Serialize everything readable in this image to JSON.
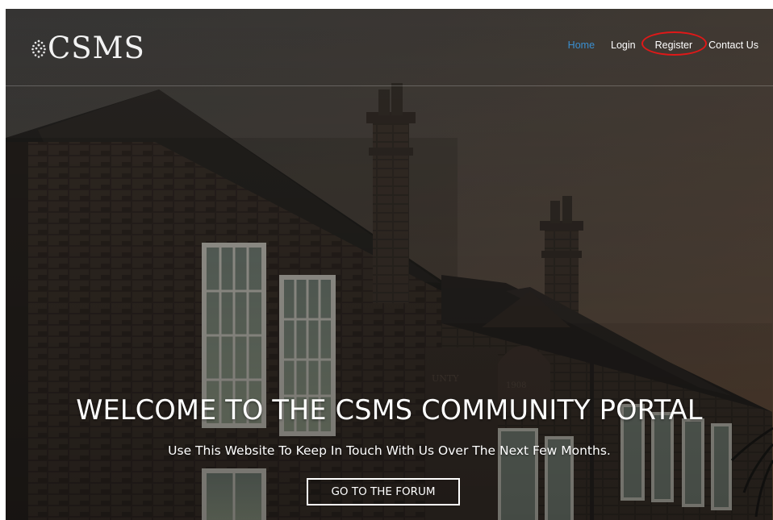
{
  "header": {
    "logo_text": "CSMS",
    "logo_icon": "globe-dots-icon"
  },
  "nav": {
    "items": [
      {
        "label": "Home",
        "active": true
      },
      {
        "label": "Login",
        "active": false
      },
      {
        "label": "Register",
        "active": false,
        "annotated": true
      },
      {
        "label": "Contact Us",
        "active": false
      }
    ]
  },
  "hero": {
    "title": "WELCOME TO THE CSMS COMMUNITY PORTAL",
    "subtitle": "Use This Website To Keep In Touch With Us Over The Next Few Months.",
    "cta_label": "GO TO THE FORUM",
    "background": "stone school building with chimneys at dusk"
  },
  "colors": {
    "active_nav": "#3a8fd0",
    "annotation_ring": "#e01818",
    "overlay": "#3d3b38"
  }
}
